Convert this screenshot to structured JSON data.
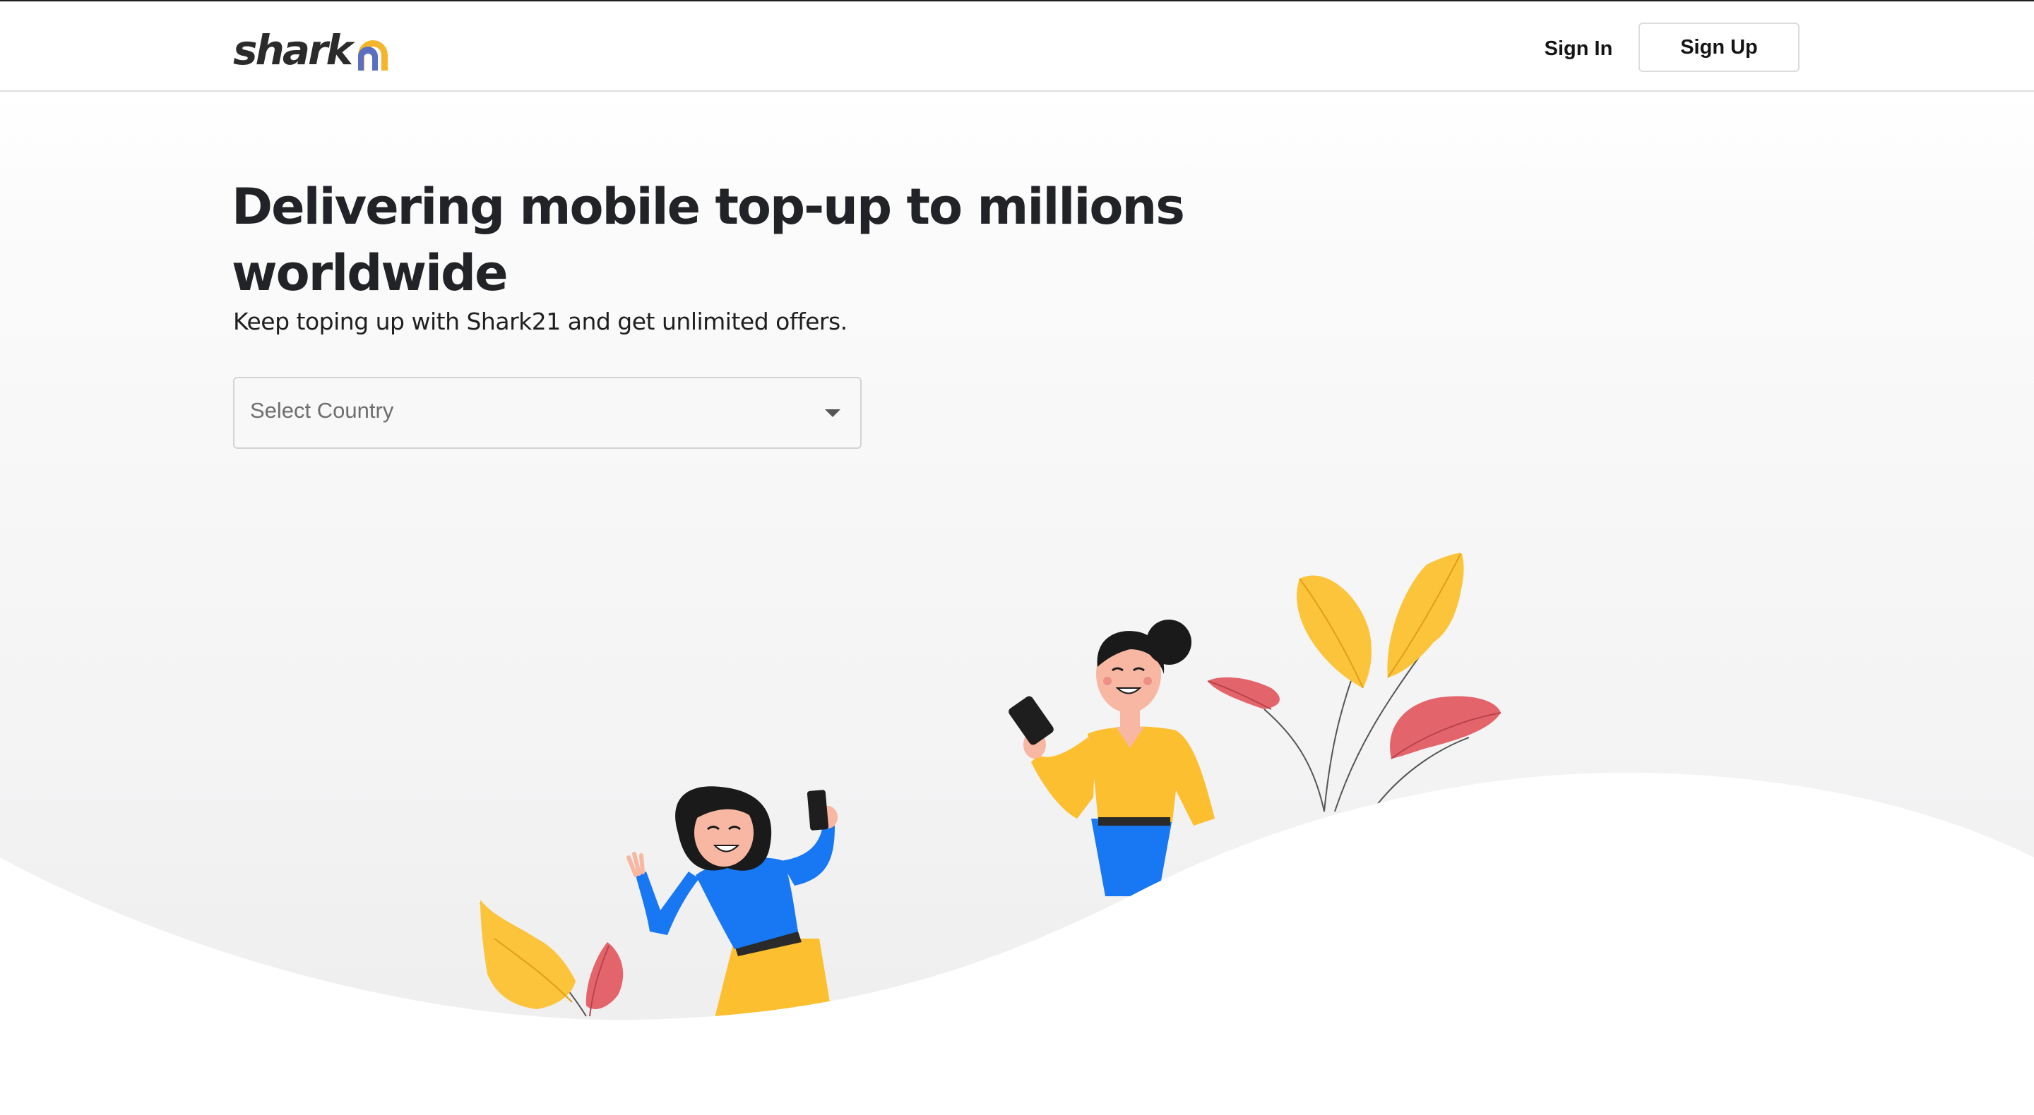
{
  "header": {
    "logo_text": "shark",
    "signin_label": "Sign In",
    "signup_label": "Sign Up"
  },
  "hero": {
    "title": "Delivering mobile top-up to millions worldwide",
    "subtitle": "Keep toping up with Shark21 and get unlimited offers."
  },
  "country_select": {
    "placeholder": "Select Country"
  },
  "colors": {
    "brand_blue": "#5b6fc1",
    "brand_yellow": "#f4b42c",
    "leaf_yellow": "#fcc43b",
    "leaf_red": "#e4646c",
    "shirt_blue": "#1877f2",
    "shirt_yellow": "#fcbf2f"
  },
  "icons": {
    "logo_mark": "rainbow-arch-icon",
    "select_caret": "caret-down-icon"
  }
}
